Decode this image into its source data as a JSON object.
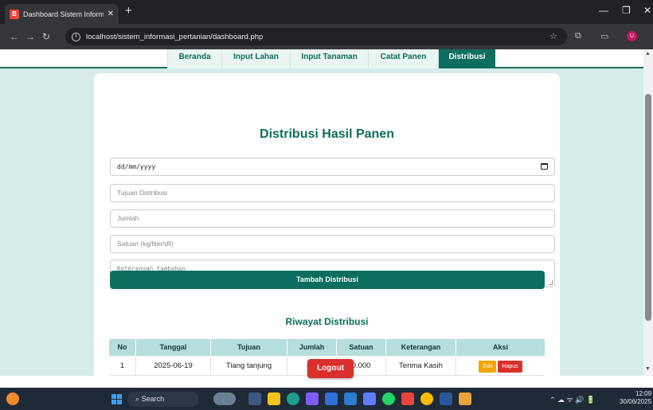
{
  "browser": {
    "tab_title": "Dashboard  Sistem Informasi",
    "tab_favicon": "B",
    "url": "localhost/sistem_informasi_pertanian/dashboard.php",
    "profile_initial": "U"
  },
  "nav": {
    "items": [
      "Beranda",
      "Input Lahan",
      "Input Tanaman",
      "Catat Panen",
      "Distribusi"
    ],
    "active": "Distribusi"
  },
  "form": {
    "title": "Distribusi Hasil Panen",
    "date_placeholder": "dd/mm/yyyy",
    "tujuan_placeholder": "Tujuan Distribusi",
    "jumlah_placeholder": "Jumlah",
    "satuan_placeholder": "Satuan (kg/liter/dll)",
    "keterangan_placeholder": "Keterangan tambahan",
    "submit_label": "Tambah Distribusi"
  },
  "history": {
    "title": "Riwayat Distribusi",
    "columns": [
      "No",
      "Tanggal",
      "Tujuan",
      "Jumlah",
      "Satuan",
      "Keterangan",
      "Aksi"
    ],
    "rows": [
      {
        "no": "1",
        "tanggal": "2025-06-19",
        "tujuan": "Tiang tanjung",
        "jumlah": "1",
        "satuan": "0.000",
        "keterangan": "Terima Kasih",
        "edit": "Edit",
        "hapus": "Hapus"
      }
    ]
  },
  "logout_label": "Logout",
  "taskbar": {
    "search_label": "Search",
    "time": "12:09",
    "date": "30/06/2025"
  },
  "colors": {
    "primary": "#0c6e5e",
    "page_bg": "#d6ecea",
    "table_header": "#b5dedc",
    "danger": "#d9302c",
    "warning": "#f0a500"
  }
}
